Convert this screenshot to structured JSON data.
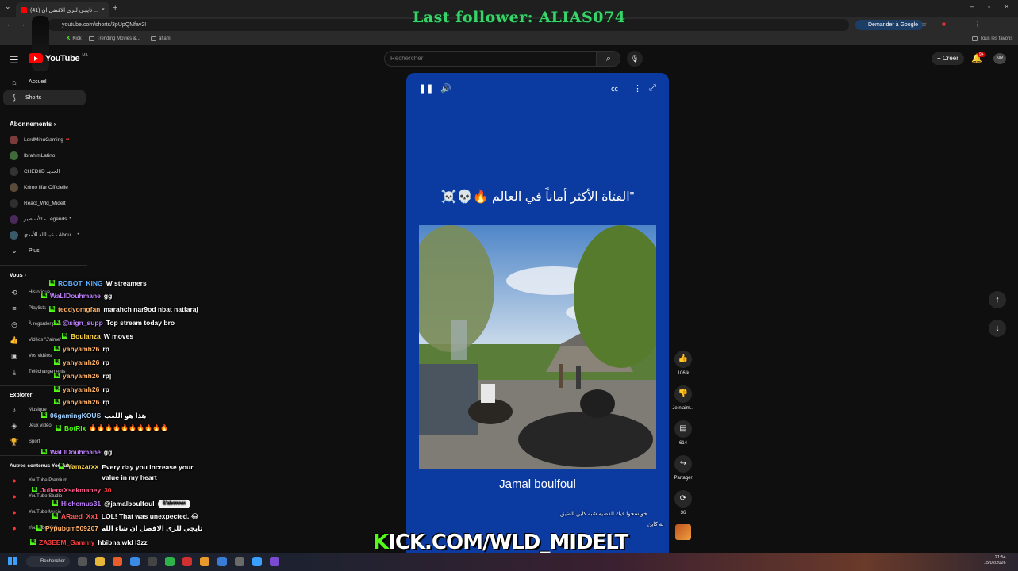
{
  "browser": {
    "tab_title": "(41) تايجي للرى الافضل ان ...",
    "url": "youtube.com/shorts/3pUpQMfav2I",
    "ask_google": "Demander à Google",
    "bookmarks": [
      "Kick",
      "Trending Movies &...",
      "aflam"
    ],
    "all_bookmarks": "Tous les favoris"
  },
  "overlay": {
    "last_follower": "Last follower: ALIAS074",
    "kick_prefix": "K",
    "kick_rest": "ICK.COM/WLD_MIDELT"
  },
  "youtube": {
    "logo": "YouTube",
    "logo_country": "MA",
    "search_placeholder": "Rechercher",
    "create": "Créer",
    "notif_count": "9+",
    "avatar": "NR"
  },
  "sidebar": {
    "home": "Accueil",
    "shorts": "Shorts",
    "subscriptions": "Abonnements",
    "subs": [
      {
        "name": "LordMinuGaming",
        "color": "#7a3b3b",
        "live": "▪▪"
      },
      {
        "name": "IbrahimLatino",
        "color": "#3f6b3a",
        "live": ""
      },
      {
        "name": "CHEDIID الحديد",
        "color": "#333333",
        "live": ""
      },
      {
        "name": "Krimo lifar Officielle",
        "color": "#5a4a3a",
        "live": ""
      },
      {
        "name": "React_Wld_Midelt",
        "color": "#2f2f2f",
        "live": ""
      },
      {
        "name": "الأساطير - Legends",
        "color": "#4a2a5a",
        "live": "•"
      },
      {
        "name": "عبدالله الأمدي - Abdu...",
        "color": "#3a5a6a",
        "live": "•"
      }
    ],
    "more": "Plus",
    "you": "Vous",
    "you_items": [
      "Historique",
      "Playlists",
      "À regarder plus tard",
      "Vidéos \"J'aime\"",
      "Vos vidéos",
      "Téléchargements"
    ],
    "explore": "Explorer",
    "explore_items": [
      "Musique",
      "Jeux vidéo",
      "Sport"
    ],
    "other": "Autres contenus YouTube",
    "other_items": [
      "YouTube Premium",
      "YouTube Studio",
      "YouTube Music",
      "YouTube Kids"
    ]
  },
  "chat": [
    {
      "user": "ROBOT_KING",
      "color": "#5fb0ff",
      "msg": "W streamers"
    },
    {
      "user": "WaLIDouhmane",
      "color": "#c080ff",
      "msg": "gg"
    },
    {
      "user": "teddyomgfan",
      "color": "#ffb36b",
      "msg": "marahch nar9od nbat natfaraj"
    },
    {
      "user": "@sign_supp",
      "color": "#c080ff",
      "msg": "Top stream today bro"
    },
    {
      "user": "Boulanza",
      "color": "#ffd84a",
      "msg": "W moves"
    },
    {
      "user": "yahyamh26",
      "color": "#ffb36b",
      "msg": "rp"
    },
    {
      "user": "yahyamh26",
      "color": "#ffb36b",
      "msg": "rp"
    },
    {
      "user": "yahyamh26",
      "color": "#ffb36b",
      "msg": "rp|"
    },
    {
      "user": "yahyamh26",
      "color": "#ffb36b",
      "msg": "rp"
    },
    {
      "user": "yahyamh26",
      "color": "#ffb36b",
      "msg": "rp"
    },
    {
      "user": "06gamingKOUS",
      "color": "#9fd0ff",
      "msg": "هذا هو اللعب"
    },
    {
      "user": "BotRix",
      "color": "#53fc18",
      "msg": "🔥🔥🔥🔥🔥🔥🔥🔥🔥🔥"
    },
    {
      "user": "WaLIDouhmane",
      "color": "#c080ff",
      "msg": "gg"
    },
    {
      "user": "Yamzarxx",
      "color": "#ffd84a",
      "msg": "Every day you increase your value in my heart"
    },
    {
      "user": "JullenaXsekmaney",
      "color": "#ff5a8a",
      "msg": "30"
    },
    {
      "user": "Hichemus31",
      "color": "#c080ff",
      "msg": "@jamalboulfoul"
    },
    {
      "user": "ARaed_Xx1",
      "color": "#ff5a5a",
      "msg": "LOL! That was unexpected. 😂"
    },
    {
      "user": "Pypubgm509207",
      "color": "#ffb36b",
      "msg": "تايجي للرى الافضل ان شاء الله"
    },
    {
      "user": "ZA3EEM_Gammy",
      "color": "#ff4040",
      "msg": "hbibna wld l3zz"
    }
  ],
  "player": {
    "arabic_title": "\"الفتاة الأكثر أماناً في العالم 🔥💀☠️",
    "caption": "Jamal boulfoul",
    "subscribe": "S'abonner",
    "desc1": "خويسحوا فيك الفضيه شبه كاين الضيق",
    "desc2": "به كاين"
  },
  "actions": {
    "likes": "106 k",
    "dislike": "Je n'aim...",
    "comments": "614",
    "share": "Partager",
    "remix": "36"
  },
  "taskbar": {
    "search": "Rechercher",
    "time": "21:54",
    "date": "15/02/2026"
  }
}
